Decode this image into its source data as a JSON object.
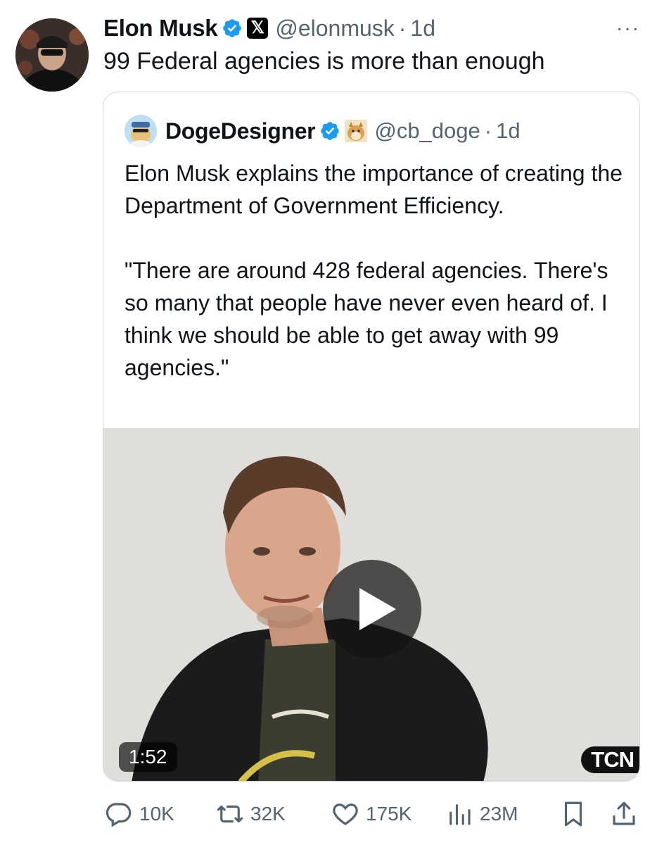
{
  "tweet": {
    "author_name": "Elon Musk",
    "handle": "@elonmusk",
    "separator": "·",
    "time": "1d",
    "more_label": "···",
    "text": "99 Federal agencies is more than enough",
    "avatar_icon": "profile-photo",
    "x_badge": "𝕏"
  },
  "quote": {
    "author_name": "DogeDesigner",
    "handle": "@cb_doge",
    "separator": "·",
    "time": "1d",
    "paragraph1": "Elon Musk explains the importance of creating the Department of Government Efficiency.",
    "paragraph2": "\"There are around 428 federal agencies. There's so many that people have never even heard of. I think we should be able to get away with 99 agencies.\"",
    "video": {
      "duration": "1:52",
      "watermark": "TCN"
    }
  },
  "actions": {
    "replies": "10K",
    "reposts": "32K",
    "likes": "175K",
    "views": "23M"
  },
  "colors": {
    "verified": "#1d9bf0",
    "secondary_text": "#536471",
    "border": "#cfd9de"
  }
}
